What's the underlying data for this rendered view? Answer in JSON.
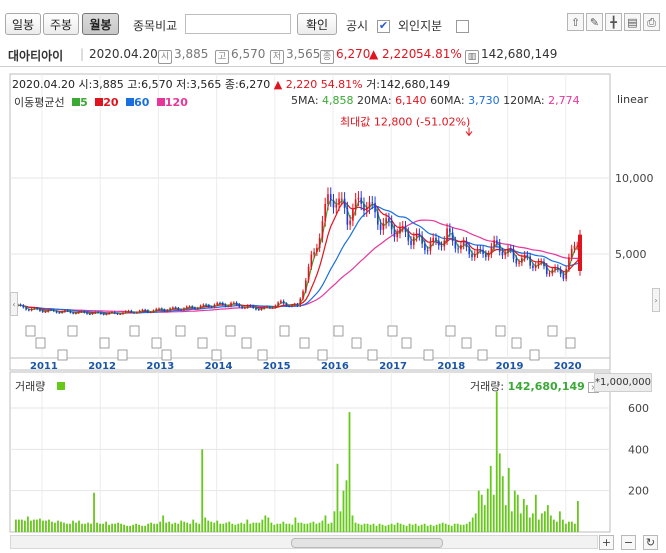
{
  "toolbar": {
    "period_tabs": [
      "일봉",
      "주봉",
      "월봉"
    ],
    "active_tab": "월봉",
    "compare_label": "종목비교",
    "confirm_label": "확인",
    "disclosure_label": "공시",
    "disclosure_checked": "✔",
    "foreign_label": "외인지분"
  },
  "info": {
    "name": "대아티아이",
    "date": "2020.04.20",
    "open_label": "시",
    "open": "3,885",
    "high_label": "고",
    "high": "6,570",
    "low_label": "저",
    "low": "3,565",
    "close_label": "종",
    "close": "6,270",
    "change": "▲ 2,220",
    "change_pct": "54.81%",
    "volume": "142,680,149"
  },
  "stat_line": {
    "text": "2020.04.20 시:3,885 고:6,570 저:3,565 종:6,270",
    "change": "▲ 2,220 54.81%",
    "volume": "거:142,680,149"
  },
  "legend": {
    "title": "이동평균선",
    "ma5": "5",
    "ma20": "20",
    "ma60": "60",
    "ma120": "120"
  },
  "ma_values": {
    "ma5_label": "5MA:",
    "ma5": "4,858",
    "ma20_label": "20MA:",
    "ma20": "6,140",
    "ma60_label": "60MA:",
    "ma60": "3,730",
    "ma120_label": "120MA:",
    "ma120": "2,774"
  },
  "scale_label": "linear",
  "volume_panel": {
    "label": "거래량",
    "value_label": "거래량:",
    "value": "142,680,149",
    "unit": "*1,000,000"
  },
  "colors": {
    "up": "#e0141e",
    "down": "#1f3fd6",
    "ma5": "#3aaa35",
    "ma20": "#e0141e",
    "ma60": "#1a6fdf",
    "ma120": "#e8359c",
    "volume": "#66c81a"
  },
  "chart_data": [
    {
      "type": "candlestick",
      "title": "",
      "max_annotation": "최대값 12,800 (-51.02%)",
      "x_ticks": [
        "2011",
        "2012",
        "2013",
        "2014",
        "2015",
        "2016",
        "2017",
        "2018",
        "2019",
        "2020"
      ],
      "y_ticks": [
        5000,
        10000
      ],
      "ylim": [
        0,
        14000
      ],
      "scale": "linear",
      "last_candle": {
        "date": "2020.04",
        "open": 3885,
        "high": 6570,
        "low": 3565,
        "close": 6270
      },
      "max_price": 12800,
      "series": [
        {
          "name": "5",
          "value": 4858
        },
        {
          "name": "20",
          "value": 6140
        },
        {
          "name": "60",
          "value": 3730
        },
        {
          "name": "120",
          "value": 2774
        }
      ],
      "price_path": [
        1600,
        1350,
        1250,
        1200,
        1150,
        1100,
        1100,
        1200,
        1250,
        1350,
        1400,
        1500,
        1650,
        1700,
        1500,
        1400,
        1800,
        1550,
        5200,
        9000,
        7500,
        8500,
        7000,
        6500,
        6000,
        5500,
        6200,
        5400,
        5000,
        5600,
        4800,
        4500,
        4000,
        3650,
        6270
      ]
    },
    {
      "type": "bar",
      "ylabel": "거래량",
      "y_ticks": [
        200,
        400,
        600
      ],
      "ylim": [
        0,
        700
      ],
      "units": "*1,000,000",
      "values": [
        60,
        60,
        60,
        55,
        75,
        55,
        60,
        60,
        65,
        55,
        55,
        60,
        50,
        45,
        55,
        50,
        45,
        40,
        40,
        55,
        45,
        55,
        40,
        40,
        45,
        40,
        190,
        45,
        40,
        40,
        50,
        35,
        40,
        40,
        45,
        40,
        35,
        30,
        30,
        35,
        40,
        35,
        30,
        30,
        40,
        45,
        40,
        40,
        50,
        80,
        45,
        50,
        40,
        45,
        40,
        55,
        50,
        45,
        40,
        60,
        45,
        40,
        400,
        70,
        55,
        50,
        45,
        55,
        40,
        40,
        45,
        50,
        40,
        35,
        40,
        45,
        40,
        60,
        40,
        45,
        45,
        45,
        60,
        80,
        70,
        45,
        35,
        40,
        40,
        50,
        40,
        40,
        35,
        70,
        45,
        45,
        40,
        40,
        45,
        50,
        40,
        45,
        55,
        80,
        40,
        45,
        100,
        330,
        100,
        200,
        250,
        580,
        80,
        45,
        40,
        35,
        40,
        40,
        35,
        40,
        30,
        40,
        35,
        30,
        35,
        40,
        35,
        45,
        40,
        35,
        30,
        40,
        35,
        40,
        30,
        35,
        40,
        30,
        35,
        30,
        35,
        40,
        45,
        40,
        35,
        30,
        40,
        40,
        35,
        35,
        40,
        50,
        70,
        90,
        200,
        180,
        130,
        210,
        320,
        180,
        680,
        380,
        270,
        130,
        310,
        100,
        200,
        180,
        90,
        160,
        130,
        70,
        90,
        180,
        60,
        90,
        100,
        130,
        80,
        60,
        50,
        100,
        60,
        40,
        50,
        50,
        40,
        150
      ]
    }
  ]
}
